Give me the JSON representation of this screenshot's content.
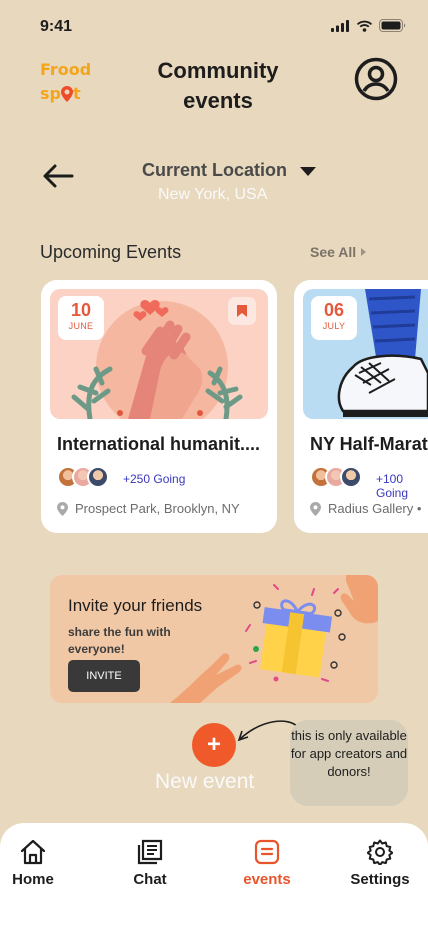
{
  "status_bar": {
    "time": "9:41"
  },
  "header": {
    "logo_line1": "Frood",
    "logo_line2_a": "sp",
    "logo_line2_b": "t",
    "title": "Community events"
  },
  "location": {
    "label": "Current Location",
    "value": "New York, USA"
  },
  "upcoming": {
    "title": "Upcoming Events",
    "see_all": "See All",
    "events": [
      {
        "day": "10",
        "month": "JUNE",
        "title": "International  humanit....",
        "going": "+250 Going",
        "location": "Prospect Park, Brooklyn, NY"
      },
      {
        "day": "06",
        "month": "JULY",
        "title": "NY Half-Marat",
        "going": "+100 Going",
        "location": "Radius Gallery •"
      }
    ]
  },
  "invite": {
    "title": "Invite your friends",
    "subtitle": "share the fun with everyone!",
    "button": "INVITE"
  },
  "new_event": {
    "label": "New event",
    "note": "this is only available for app creators and donors!"
  },
  "tabs": [
    {
      "label": "Home",
      "icon": "home-icon"
    },
    {
      "label": "Chat",
      "icon": "chat-icon"
    },
    {
      "label": "events",
      "icon": "events-icon"
    },
    {
      "label": "Settings",
      "icon": "gear-icon"
    }
  ],
  "colors": {
    "background": "#e8d8bd",
    "accent": "#f05a2a",
    "logo": "#f4a51c",
    "going": "#3a38c0"
  }
}
